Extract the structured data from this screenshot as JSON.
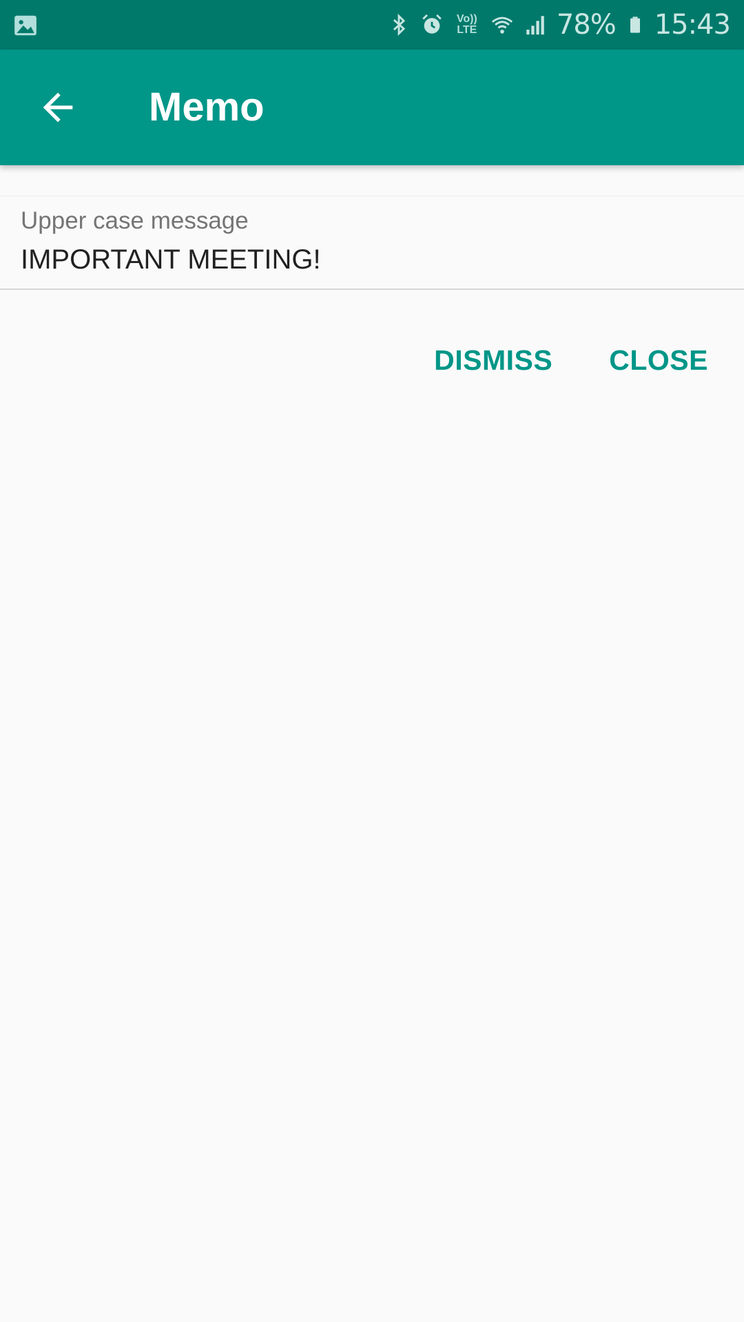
{
  "status_bar": {
    "left_icon": "image-notification-icon",
    "icons": [
      "bluetooth-icon",
      "alarm-icon",
      "volte-icon",
      "wifi-icon",
      "signal-icon"
    ],
    "volte_text": "Vo)) LTE",
    "battery_percent": "78%",
    "time": "15:43",
    "colors": {
      "background": "#00796b",
      "foreground": "#c8e6e2"
    }
  },
  "app_bar": {
    "title": "Memo",
    "back_icon": "arrow-back-icon",
    "color": "#009688"
  },
  "field": {
    "label": "Upper case message",
    "value": "IMPORTANT MEETING!"
  },
  "actions": {
    "dismiss_label": "DISMISS",
    "close_label": "CLOSE",
    "accent": "#009688"
  }
}
